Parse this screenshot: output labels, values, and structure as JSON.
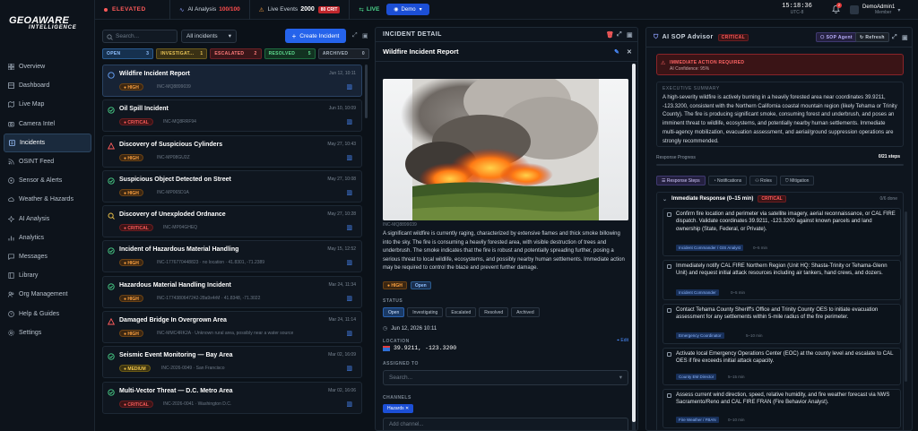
{
  "brand": {
    "logo": "GEOAWARE",
    "sub": "INTELLIGENCE"
  },
  "nav": [
    {
      "label": "Overview",
      "icon": "grid-icon"
    },
    {
      "label": "Dashboard",
      "icon": "dashboard-icon"
    },
    {
      "label": "Live Map",
      "icon": "map-icon"
    },
    {
      "label": "Camera Intel",
      "icon": "camera-icon"
    },
    {
      "label": "Incidents",
      "icon": "incidents-icon",
      "active": true
    },
    {
      "label": "OSINT Feed",
      "icon": "feed-icon"
    },
    {
      "label": "Sensor & Alerts",
      "icon": "sensor-icon"
    },
    {
      "label": "Weather & Hazards",
      "icon": "weather-icon"
    },
    {
      "label": "AI Analysis",
      "icon": "ai-icon"
    },
    {
      "label": "Analytics",
      "icon": "analytics-icon"
    },
    {
      "label": "Messages",
      "icon": "messages-icon"
    },
    {
      "label": "Library",
      "icon": "library-icon"
    },
    {
      "label": "Org Management",
      "icon": "org-icon"
    },
    {
      "label": "Help & Guides",
      "icon": "help-icon"
    },
    {
      "label": "Settings",
      "icon": "settings-icon"
    }
  ],
  "topbar": {
    "threat": "ELEVATED",
    "ai_label": "AI Analysis",
    "ai_value": "100/100",
    "events_label": "Live Events",
    "events_value": "2000",
    "events_badge": "80 CRIT",
    "live": "LIVE",
    "demo": "Demo",
    "time": "15:18:36",
    "zone": "UTC-8",
    "notif_count": "2",
    "user_name": "DemoAdmin1",
    "user_role": "Member"
  },
  "list": {
    "search_placeholder": "Search...",
    "filter": "All incidents",
    "create": "Create Incident",
    "tabs": [
      {
        "label": "OPEN",
        "count": "3"
      },
      {
        "label": "INVESTIGAT...",
        "count": "1"
      },
      {
        "label": "ESCALATED",
        "count": "2"
      },
      {
        "label": "RESOLVED",
        "count": "5"
      },
      {
        "label": "ARCHIVED",
        "count": "0"
      }
    ],
    "items": [
      {
        "title": "Wildfire Incident Report",
        "date": "Jun 12, 10:11",
        "sev": "HIGH",
        "meta": "INC-MQ8899039",
        "status": "open"
      },
      {
        "title": "Oil Spill Incident",
        "date": "Jun 10, 10:09",
        "sev": "CRITICAL",
        "meta": "INC-MQ8RRF94",
        "status": "resolved"
      },
      {
        "title": "Discovery of Suspicious Cylinders",
        "date": "May 27, 10:43",
        "sev": "HIGH",
        "meta": "INC-MP08GU2Z",
        "status": "escalated"
      },
      {
        "title": "Suspicious Object Detected on Street",
        "date": "May 27, 10:08",
        "sev": "HIGH",
        "meta": "INC-MP065D1A",
        "status": "resolved"
      },
      {
        "title": "Discovery of Unexploded Ordnance",
        "date": "May 27, 10:28",
        "sev": "CRITICAL",
        "meta": "INC-MP04GHEQ",
        "status": "investigating"
      },
      {
        "title": "Incident of Hazardous Material Handling",
        "date": "May 15, 12:52",
        "sev": "HIGH",
        "meta": "INC-1776770448823 · no location · 41.8301, -71.2389",
        "status": "resolved"
      },
      {
        "title": "Hazardous Material Handling Incident",
        "date": "Mar 24, 11:34",
        "sev": "HIGH",
        "meta": "INC-1774380647242-28a9x4rM · 41.8348, -71.3022",
        "status": "resolved"
      },
      {
        "title": "Damaged Bridge In Overgrown Area",
        "date": "Mar 24, 11:14",
        "sev": "HIGH",
        "meta": "INC-MMC4RK2A · Unknown rural area, possibly near a water source",
        "status": "escalated"
      },
      {
        "title": "Seismic Event Monitoring — Bay Area",
        "date": "Mar 02, 16:09",
        "sev": "MEDIUM",
        "meta": "INC-2026-0049 · San Francisco",
        "status": "resolved"
      },
      {
        "title": "Multi-Vector Threat — D.C. Metro Area",
        "date": "Mar 02, 16:06",
        "sev": "CRITICAL",
        "meta": "INC-2026-0041 · Washington D.C.",
        "status": "open"
      }
    ]
  },
  "detail": {
    "panel_title": "INCIDENT DETAIL",
    "title": "Wildfire Incident Report",
    "code": "INC-MQ8899039",
    "description": "A significant wildfire is currently raging, characterized by extensive flames and thick smoke billowing into the sky. The fire is consuming a heavily forested area, with visible destruction of trees and underbrush. The smoke indicates that the fire is robust and potentially spreading further, posing a serious threat to local wildlife, ecosystems, and possibly nearby human settlements. Immediate action may be required to control the blaze and prevent further damage.",
    "sev": "HIGH",
    "status_badge": "Open",
    "status_label": "STATUS",
    "statuses": [
      "Open",
      "Investigating",
      "Escalated",
      "Resolved",
      "Archived"
    ],
    "date": "Jun 12, 2026 10:11",
    "location_label": "LOCATION",
    "coords": "39.9211, -123.3200",
    "edit": "Edit",
    "assigned_label": "ASSIGNED TO",
    "assign_placeholder": "Search...",
    "channels_label": "CHANNELS",
    "channel": "Hazards",
    "add_channel": "Add channel..."
  },
  "sop": {
    "title": "AI SOP Advisor",
    "crit": "CRITICAL",
    "agent": "SOP Agent",
    "refresh": "Refresh",
    "alert_title": "IMMEDIATE ACTION REQUIRED",
    "confidence": "AI Confidence: 95%",
    "summary_label": "EXECUTIVE SUMMARY",
    "summary": "A high-severity wildfire is actively burning in a heavily forested area near coordinates 39.9211, -123.3200, consistent with the Northern California coastal mountain region (likely Tehama or Trinity County). The fire is producing significant smoke, consuming forest and underbrush, and poses an imminent threat to wildlife, ecosystems, and potentially nearby human settlements. Immediate multi-agency mobilization, evacuation assessment, and aerial/ground suppression operations are strongly recommended.",
    "progress_label": "Response Progress",
    "progress_value": "0/21 steps",
    "progress_fraction": 0,
    "tabs": [
      "Response Steps",
      "Notifications",
      "Roles",
      "Mitigation"
    ],
    "phase_title": "Immediate Response (0–15 min)",
    "phase_tag": "CRITICAL",
    "phase_count": "0/6 done",
    "steps": [
      {
        "text": "Confirm fire location and perimeter via satellite imagery, aerial reconnaissance, or CAL FIRE dispatch. Validate coordinates 39.9211, -123.3200 against known parcels and land ownership (State, Federal, or Private).",
        "role": "Incident Commander / GIS Analyst",
        "dur": "0–5 min"
      },
      {
        "text": "Immediately notify CAL FIRE Northern Region (Unit HQ: Shasta-Trinity or Tehama-Glenn Unit) and request initial attack resources including air tankers, hand crews, and dozers.",
        "role": "Incident Commander",
        "dur": "0–5 min"
      },
      {
        "text": "Contact Tehama County Sheriff's Office and Trinity County OES to initiate evacuation assessment for any settlements within 5-mile radius of the fire perimeter.",
        "role": "Emergency Coordinator",
        "dur": "5–10 min"
      },
      {
        "text": "Activate local Emergency Operations Center (EOC) at the county level and escalate to CAL OES if fire exceeds initial attack capacity.",
        "role": "County EM Director",
        "dur": "5–15 min"
      },
      {
        "text": "Assess current wind direction, speed, relative humidity, and fire weather forecast via NWS Sacramento/Reno and CAL FIRE FRAN (Fire Behavior Analyst).",
        "role": "Fire Weather / FBAN",
        "dur": "0–10 min"
      }
    ]
  }
}
